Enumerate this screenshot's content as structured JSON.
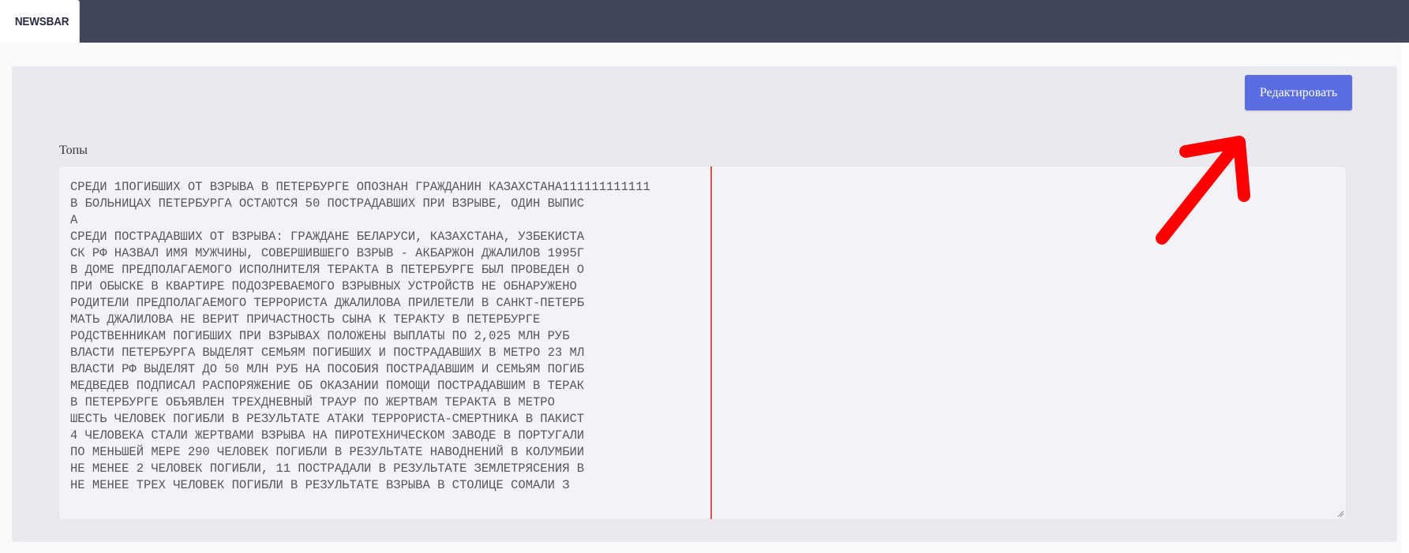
{
  "nav": {
    "active_tab": "NEWSBAR"
  },
  "toolbar": {
    "edit_label": "Редактировать"
  },
  "field": {
    "label": "Топы",
    "lines": [
      "СРЕДИ 1ПОГИБШИХ ОТ ВЗРЫВА В ПЕТЕРБУРГЕ ОПОЗНАН ГРАЖДАНИН КАЗАХСТАНА111111111111",
      "В БОЛЬНИЦАХ ПЕТЕРБУРГА ОСТАЮТСЯ 50 ПОСТРАДАВШИХ ПРИ ВЗРЫВЕ, ОДИН ВЫПИС",
      "А",
      "СРЕДИ ПОСТРАДАВШИХ ОТ ВЗРЫВА: ГРАЖДАНЕ БЕЛАРУСИ, КАЗАХСТАНА, УЗБЕКИСТА",
      "СК РФ НАЗВАЛ ИМЯ МУЖЧИНЫ, СОВЕРШИВШЕГО ВЗРЫВ - АКБАРЖОН ДЖАЛИЛОВ 1995Г",
      "В ДОМЕ ПРЕДПОЛАГАЕМОГО ИСПОЛНИТЕЛЯ ТЕРАКТА В ПЕТЕРБУРГЕ БЫЛ ПРОВЕДЕН О",
      "ПРИ ОБЫСКЕ В КВАРТИРЕ ПОДОЗРЕВАЕМОГО ВЗРЫВНЫХ УСТРОЙСТВ НЕ ОБНАРУЖЕНО",
      "РОДИТЕЛИ ПРЕДПОЛАГАЕМОГО ТЕРРОРИСТА ДЖАЛИЛОВА ПРИЛЕТЕЛИ В САНКТ-ПЕТЕРБ",
      "МАТЬ ДЖАЛИЛОВА НЕ ВЕРИТ ПРИЧАСТНОСТЬ СЫНА К ТЕРАКТУ В ПЕТЕРБУРГЕ",
      "РОДСТВЕННИКАМ ПОГИБШИХ ПРИ ВЗРЫВАХ ПОЛОЖЕНЫ ВЫПЛАТЫ ПО 2,025 МЛН РУБ",
      "ВЛАСТИ ПЕТЕРБУРГА ВЫДЕЛЯТ СЕМЬЯМ ПОГИБШИХ И ПОСТРАДАВШИХ В МЕТРО 23 МЛ",
      "ВЛАСТИ РФ ВЫДЕЛЯТ ДО 50 МЛН РУБ НА ПОСОБИЯ ПОСТРАДАВШИМ И СЕМЬЯМ ПОГИБ",
      "МЕДВЕДЕВ ПОДПИСАЛ РАСПОРЯЖЕНИЕ ОБ ОКАЗАНИИ ПОМОЩИ ПОСТРАДАВШИМ В ТЕРАК",
      "В ПЕТЕРБУРГЕ ОБЪЯВЛЕН ТРЕХДНЕВНЫЙ ТРАУР ПО ЖЕРТВАМ ТЕРАКТА В МЕТРО",
      "ШЕСТЬ ЧЕЛОВЕК ПОГИБЛИ В РЕЗУЛЬТАТЕ АТАКИ ТЕРРОРИСТА-СМЕРТНИКА В ПАКИСТ",
      "4 ЧЕЛОВЕКА СТАЛИ ЖЕРТВАМИ ВЗРЫВА НА ПИРОТЕХНИЧЕСКОМ ЗАВОДЕ В ПОРТУГАЛИ",
      "ПО МЕНЬШЕЙ МЕРЕ 290 ЧЕЛОВЕК ПОГИБЛИ В РЕЗУЛЬТАТЕ НАВОДНЕНИЙ В КОЛУМБИИ",
      "НЕ МЕНЕЕ 2 ЧЕЛОВЕК ПОГИБЛИ, 11 ПОСТРАДАЛИ В РЕЗУЛЬТАТЕ ЗЕМЛЕТРЯСЕНИЯ В",
      "НЕ МЕНЕЕ ТРЕХ ЧЕЛОВЕК ПОГИБЛИ В РЕЗУЛЬТАТЕ ВЗРЫВА В СТОЛИЦЕ СОМАЛИ З"
    ]
  },
  "colors": {
    "topbar": "#414659",
    "button": "#5b6ee1",
    "margin_line": "#d9534f",
    "annotation_arrow": "#ff0000"
  },
  "icons": {
    "annotation": "red-arrow-icon",
    "resize": "resize-grip-icon"
  }
}
